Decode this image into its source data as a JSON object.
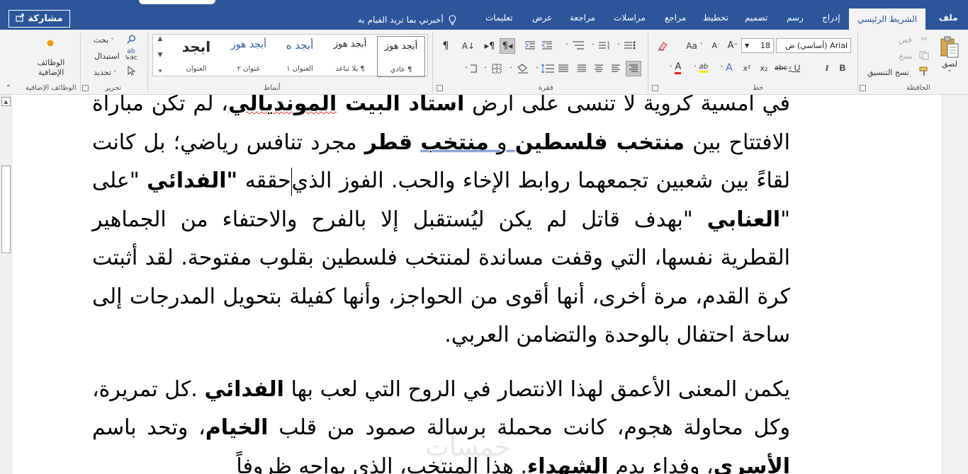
{
  "tabs": {
    "file": "ملف",
    "home": "الشريط الرئيسي",
    "insert": "إدراج",
    "draw": "رسم",
    "design": "تصميم",
    "layout": "تخطيط",
    "references": "مراجع",
    "mailings": "مراسلات",
    "review": "مراجعة",
    "view": "عرض",
    "help": "تعليمات",
    "tell_me": "أخبرني بما تريد القيام به",
    "share": "مشاركة"
  },
  "ribbon": {
    "clipboard": {
      "label": "الحافظة",
      "paste": "لصق",
      "cut": "قص",
      "copy": "نسخ",
      "format_painter": "نسخ التنسيق"
    },
    "font": {
      "label": "خط",
      "font_name": "Arial (أساسي) ض",
      "font_size": "18",
      "bold": "B",
      "italic": "I",
      "underline": "U",
      "strike": "abc",
      "subscript": "x₂",
      "superscript": "x²",
      "grow": "A",
      "shrink": "A",
      "case": "Aa",
      "clear": "A",
      "text_effects": "A",
      "highlight": "ab",
      "font_color": "A"
    },
    "paragraph": {
      "label": "فقرة"
    },
    "styles": {
      "label": "أنماط",
      "items": [
        {
          "preview": "أبجد هوز",
          "name": "¶ عادي"
        },
        {
          "preview": "أبجد هوز",
          "name": "¶ بلا تباعد"
        },
        {
          "preview": "أبجد ه",
          "name": "العنوان ١"
        },
        {
          "preview": "أبجد هوز",
          "name": "عنوان ٢"
        },
        {
          "preview": "ابجد",
          "name": "العنوان"
        }
      ]
    },
    "editing": {
      "label": "تحرير",
      "find": "بحث",
      "replace": "استبدال",
      "select": "تحديد"
    },
    "addins": {
      "label": "الوظائف الإضافية",
      "button": "الوظائف الإضافية"
    }
  },
  "document": {
    "paragraph1": {
      "line1_before": "في أمسية كروية لا تنسى على أرض ",
      "line1_bold1": "استاد البيت ",
      "line1_bold_red": "المونديالي",
      "line1_after": "، لم تكن",
      "l2_a": "مباراة الافتتاح بين ",
      "l2_b1": "منتخب فلسطين",
      "l2_c": " و ",
      "l2_b2": "منتخب",
      "l2_d": " ",
      "l2_b3": "قطر",
      "l2_e": " مجرد تنافس رياضي؛",
      "l3_a": "بل كانت لقاءً بين شعبين تجمعهما روابط الإخاء والحب. الفوز الذي",
      "l3_b": "حققه",
      "l4_a": "\"",
      "l4_b1": "الفدائي",
      "l4_c": " \"على \"",
      "l4_b2": "العنابي",
      "l4_d": " \"بهدف قاتل لم يكن ليُستقبل إلا بالفرح والاحتفاء",
      "rest": "من الجماهير القطرية نفسها، التي وقفت مساندة لمنتخب فلسطين بقلوب مفتوحة. لقد أثبتت كرة القدم، مرة أخرى، أنها أقوى من الحواجز، وأنها كفيلة بتحويل المدرجات إلى ساحة احتفال بالوحدة والتضامن العربي."
    },
    "paragraph2": {
      "a": "يكمن المعنى الأعمق لهذا الانتصار في الروح التي لعب بها ",
      "b1": "الفدائي",
      "c": " .كل تمريرة، وكل محاولة هجوم، كانت محملة برسالة صمود من قلب ",
      "b2": "الخيام",
      "d": "، وتحد باسم ",
      "b3": "الأسرى",
      "e": "، وفداء بدم ",
      "b4": "الشهداء",
      "f": ". هذا المنتخب، الذي يواجه ظروفاً"
    },
    "watermark": "خمسات"
  },
  "colors": {
    "brand": "#2b579a",
    "ribbon_bg": "#f3f3f3",
    "spell_error": "#e03030",
    "grammar": "#3d62c8"
  }
}
